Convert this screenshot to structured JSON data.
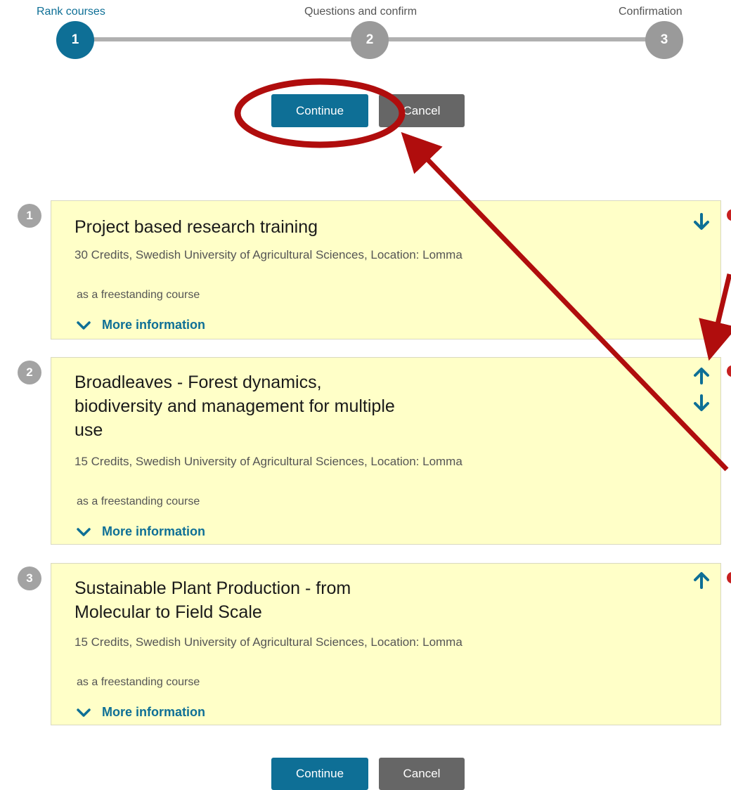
{
  "stepper": {
    "steps": [
      {
        "label": "Rank courses",
        "number": "1"
      },
      {
        "label": "Questions and confirm",
        "number": "2"
      },
      {
        "label": "Confirmation",
        "number": "3"
      }
    ]
  },
  "actions": {
    "continue_label": "Continue",
    "cancel_label": "Cancel"
  },
  "courses": [
    {
      "rank": "1",
      "title": "Project based research training",
      "meta": "30 Credits, Swedish University of Agricultural Sciences, Location: Lomma",
      "mode": "as a freestanding course",
      "more_info": "More information"
    },
    {
      "rank": "2",
      "title": "Broadleaves - Forest dynamics, biodiversity and management for multiple use",
      "meta": "15 Credits, Swedish University of Agricultural Sciences, Location: Lomma",
      "mode": "as a freestanding course",
      "more_info": "More information"
    },
    {
      "rank": "3",
      "title": "Sustainable Plant Production - from Molecular to Field Scale",
      "meta": "15 Credits, Swedish University of Agricultural Sciences, Location: Lomma",
      "mode": "as a freestanding course",
      "more_info": "More information"
    }
  ],
  "colors": {
    "primary": "#0e6f96",
    "secondary": "#666666",
    "card_background": "#ffffc8",
    "inactive_step": "#9a9a9a",
    "annotation": "#b00d0d"
  },
  "icons": {
    "move_up": "arrow-up-icon",
    "move_down": "arrow-down-icon",
    "expand": "chevron-down-icon"
  }
}
